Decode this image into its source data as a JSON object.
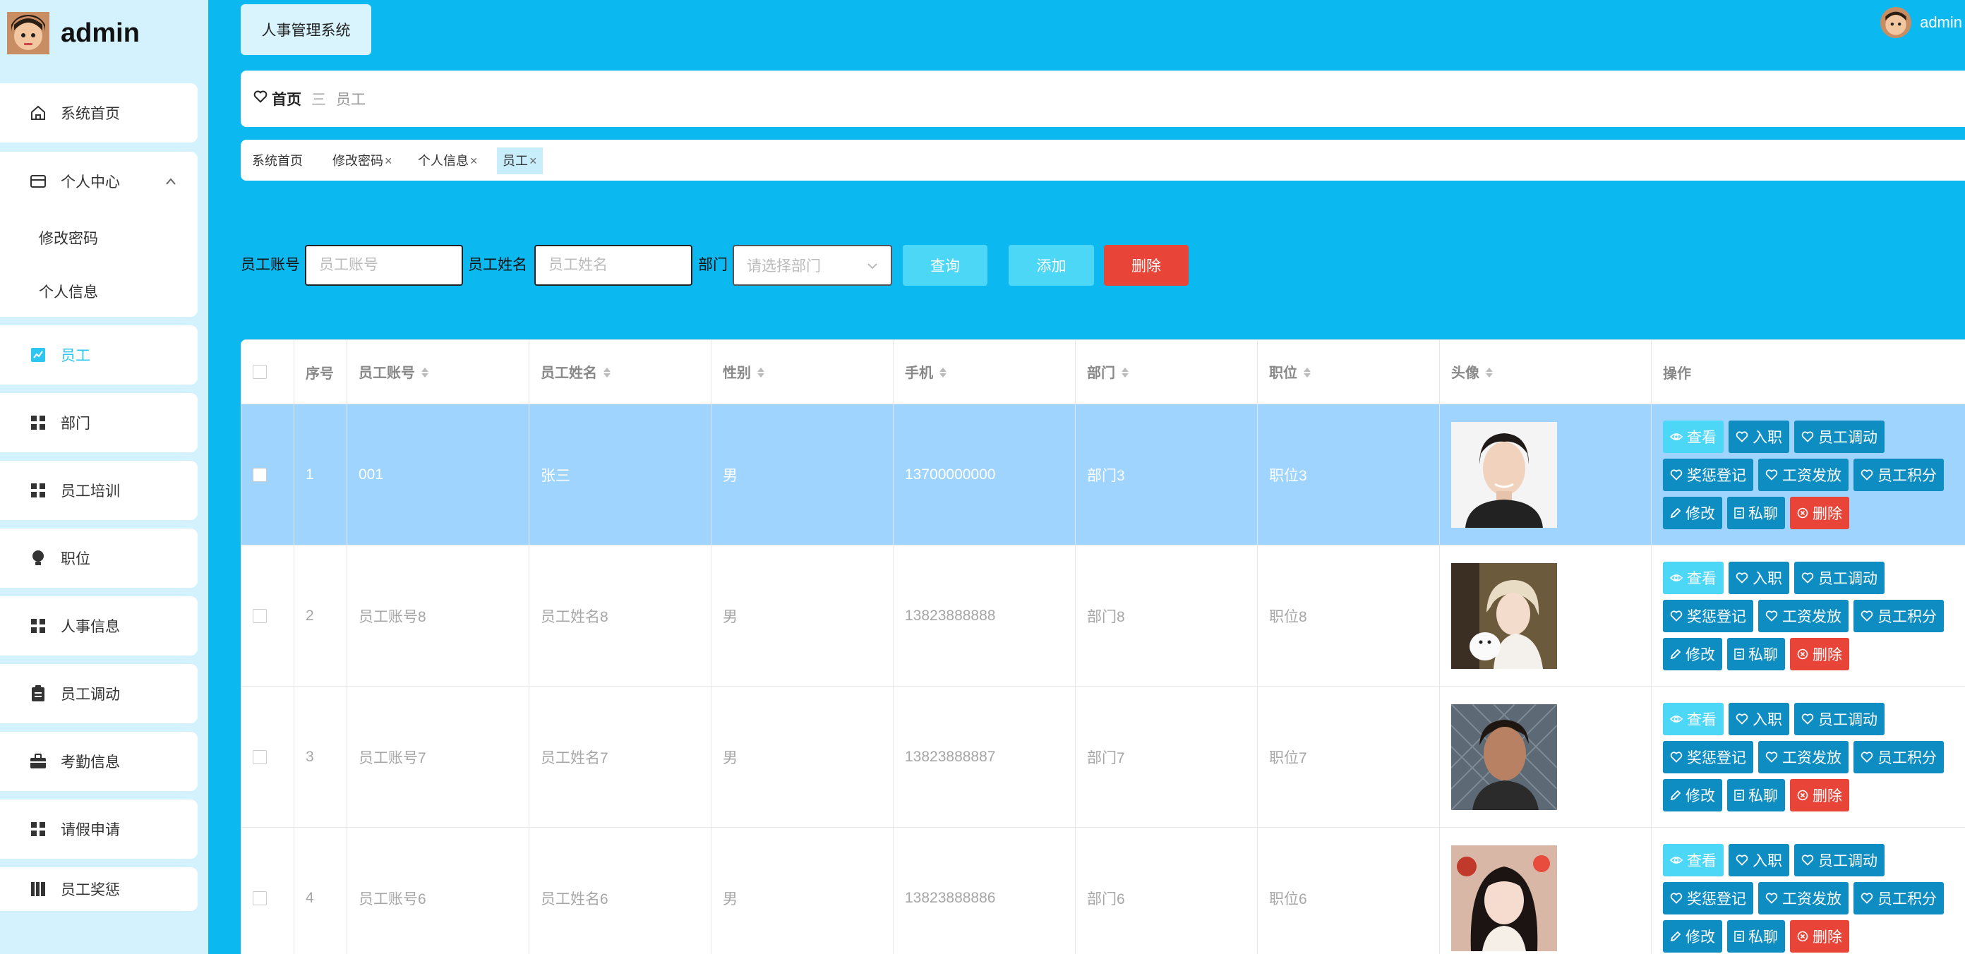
{
  "app": {
    "brand_name": "admin",
    "system_tab": "人事管理系统",
    "user_name": "admin"
  },
  "sidebar": {
    "items": [
      {
        "label": "系统首页",
        "icon": "home-icon"
      },
      {
        "label": "个人中心",
        "icon": "card-icon",
        "expanded": true,
        "children": [
          {
            "label": "修改密码"
          },
          {
            "label": "个人信息"
          }
        ]
      },
      {
        "label": "员工",
        "icon": "chart-icon",
        "active": true
      },
      {
        "label": "部门",
        "icon": "grid-icon"
      },
      {
        "label": "员工培训",
        "icon": "grid-icon"
      },
      {
        "label": "职位",
        "icon": "bulb-icon"
      },
      {
        "label": "人事信息",
        "icon": "grid-icon"
      },
      {
        "label": "员工调动",
        "icon": "clipboard-icon"
      },
      {
        "label": "考勤信息",
        "icon": "briefcase-icon"
      },
      {
        "label": "请假申请",
        "icon": "grid-icon"
      },
      {
        "label": "员工奖惩",
        "icon": "book-icon"
      }
    ]
  },
  "breadcrumb": {
    "home": "首页",
    "separator": "三",
    "current": "员工"
  },
  "tags": [
    {
      "label": "系统首页",
      "closable": false
    },
    {
      "label": "修改密码",
      "closable": true
    },
    {
      "label": "个人信息",
      "closable": true
    },
    {
      "label": "员工",
      "closable": true,
      "active": true
    }
  ],
  "search": {
    "account_label": "员工账号",
    "account_placeholder": "员工账号",
    "name_label": "员工姓名",
    "name_placeholder": "员工姓名",
    "dept_label": "部门",
    "dept_placeholder": "请选择部门",
    "query_button": "查询",
    "add_button": "添加",
    "delete_button": "删除"
  },
  "table": {
    "headers": {
      "index": "序号",
      "account": "员工账号",
      "name": "员工姓名",
      "gender": "性别",
      "phone": "手机",
      "dept": "部门",
      "position": "职位",
      "avatar": "头像",
      "actions": "操作"
    },
    "rows": [
      {
        "index": "1",
        "account": "001",
        "name": "张三",
        "gender": "男",
        "phone": "13700000000",
        "dept": "部门3",
        "position": "职位3",
        "selected": true
      },
      {
        "index": "2",
        "account": "员工账号8",
        "name": "员工姓名8",
        "gender": "男",
        "phone": "13823888888",
        "dept": "部门8",
        "position": "职位8"
      },
      {
        "index": "3",
        "account": "员工账号7",
        "name": "员工姓名7",
        "gender": "男",
        "phone": "13823888887",
        "dept": "部门7",
        "position": "职位7"
      },
      {
        "index": "4",
        "account": "员工账号6",
        "name": "员工姓名6",
        "gender": "男",
        "phone": "13823888886",
        "dept": "部门6",
        "position": "职位6"
      }
    ],
    "action_labels": {
      "view": "查看",
      "onboard": "入职",
      "transfer": "员工调动",
      "reward": "奖惩登记",
      "salary": "工资发放",
      "points": "员工积分",
      "edit": "修改",
      "chat": "私聊",
      "delete": "删除"
    }
  },
  "colors": {
    "page_bg": "#0bb9f0",
    "sidebar_bg": "#d4f2fd",
    "accent": "#2cc6f0",
    "action_btn": "#0d8dc2",
    "view_btn": "#4dd7f7",
    "danger": "#e84437",
    "selected_row": "#9fd4fe"
  }
}
